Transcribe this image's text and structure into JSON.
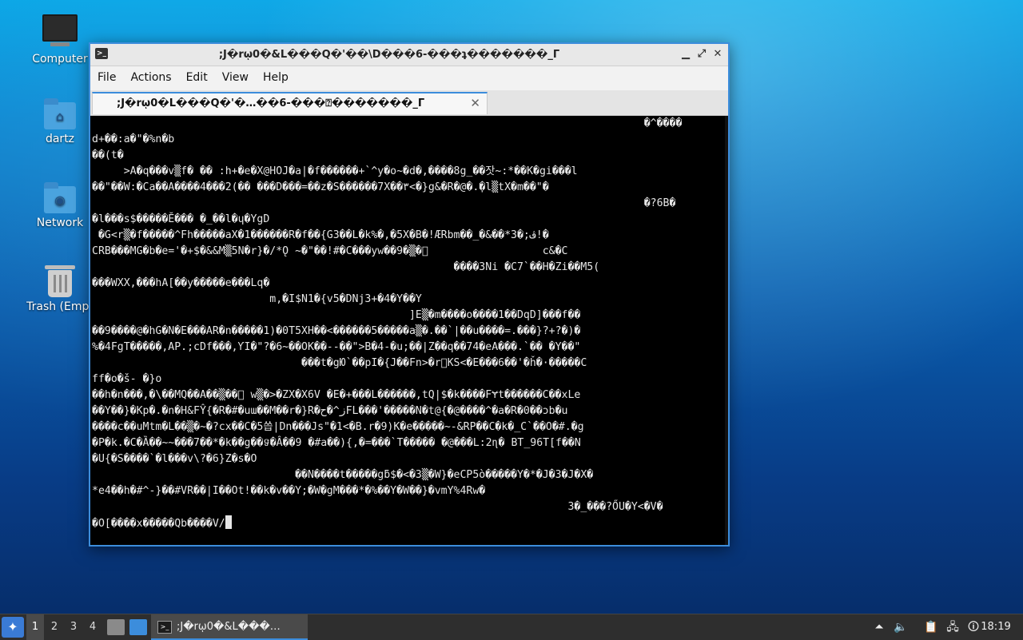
{
  "desktop": {
    "icons": [
      {
        "label": "Computer"
      },
      {
        "label": "dartz"
      },
      {
        "label": "Network"
      },
      {
        "label": "Trash (Empt"
      }
    ]
  },
  "window": {
    "title": ";Ј�rῳ0�&L���Q�'��\\D���6-���ʇ�������_Г",
    "menu": [
      "File",
      "Actions",
      "Edit",
      "View",
      "Help"
    ],
    "tab_label": ";Ј�rῳ0�L���Q�'�…��6-���⍰�������_Г",
    "terminal_lines": [
      "                                                                                       �^����",
      "d+��:a�\"�%n�b",
      "��(t�",
      "     >A�q���v▒f� �� :h+�e�X@HOJ�a|�f������+`^y�o~�d�,����8g_��잣~:*��K�gi���l",
      "��\"��W:�Ca��A����4���2(�� ���D���=��z�S������7X��٣<�}g&�R�@�.̣�l▒tX�m��\"�",
      "                                                                                       �?6B�",
      "�l���s$�����Ĕ��� �_��l�ɥ�YgD",
      " �G<r▒�f�����^Fh�����aX�1������R�f��{G3��L�k%�,�5X�B�!ÆRbm��_�&��*3�;ﭪ!�",
      "CRB���MG�b�e='�+$�&&M▒5N�r}�/*Ǫ ~�\"��!#�C���yw��9�▒�⃞                  c&�C",
      "                                                         ����3Ni �C7`��H�Zi��M5(",
      "���WXX,���hA[��y�����e���Lq�",
      "                            m,�I$N1�{v5�DNj3+�4�Y��Y",
      "                                                  ]E▒�m����o����1��DqD]���f��",
      "��9����@�hG�N�E���AR�n�����1)�0T5XH��<������5�����a▒�.��`|��u����=.���}?+?�)�",
      "%�4FgT�����,AP.;cDf���,ƳI�\"?�6~��OK��--��\">B�4-�u;��|Z��q��74�eA���.`�� �Y��\"",
      "                                 ���t�gЮ`��pI�{J��Fn>�r⃞KS<�E���6��'�ȟ�·�����C",
      "ff�o�š- �}o",
      "��h�n���,�\\��MQ��A��▒��⃞ w▒�>�ZX�X6V �E�+���L������,tQ|$�k����FɎt������C��xLe",
      "��Y��}�Kp�.�n�H&FŶ{�R�#�uɯ��M��r�}R�ز^�حFL���'�����N�t@{�@����^�a�R�0��ɔb�u",
      "����c��uMtm�L��▒�~�?cx��C�5씁|Dn���Js\"�1<�B.r�9)K�e�����~-&RP��C�k�_C`��O�#.�g",
      "�P�k.�C�Ȁ��~~���7��*�k��g��ទ�Â��9 �#a��){,�=���`T����� �@���L:2ɳ� BT_96T[f��N",
      "�U{�S����`�l���v\\?�6}Z�s�O",
      "                                ��N����t�����gƃ$�<�3▒�W}�eCP5ò�����Y�*�J�3�J�X�",
      "*e4��h�#^-}��#VR��|I��Ot!��k�v��Y;�W�gM���*�%��Y�W��}�vmY%4Rw�",
      "                                                                           3�_���?ŐU�Y<�V�",
      "�O[����x�����Qb����V/"
    ]
  },
  "taskbar": {
    "workspaces": [
      "1",
      "2",
      "3",
      "4"
    ],
    "task_label": ";Ј�rῳ0�&L���…",
    "clock": "18:19"
  }
}
